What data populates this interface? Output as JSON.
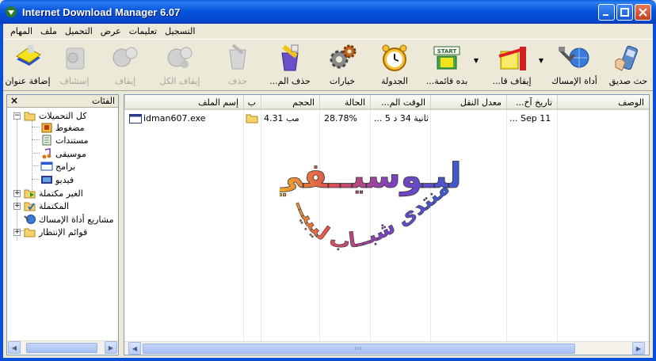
{
  "window": {
    "title": "Internet Download Manager 6.07"
  },
  "menu": [
    "المهام",
    "ملف",
    "التحميل",
    "عرض",
    "تعليمات",
    "التسجيل"
  ],
  "toolbar": {
    "buttons": [
      {
        "label": "إضافة عنوان",
        "icon": "add-url-icon",
        "disabled": false
      },
      {
        "label": "إستئناف",
        "icon": "resume-icon",
        "disabled": true
      },
      {
        "label": "إيقاف",
        "icon": "stop-icon",
        "disabled": true
      },
      {
        "label": "إيقاف الكل",
        "icon": "stop-all-icon",
        "disabled": true
      },
      {
        "label": "حذف",
        "icon": "delete-icon",
        "disabled": true
      },
      {
        "label": "...حذف الم",
        "icon": "delete-completed-icon",
        "disabled": false
      },
      {
        "label": "خيارات",
        "icon": "options-gear-icon",
        "disabled": false
      },
      {
        "label": "الجدولة",
        "icon": "scheduler-clock-icon",
        "disabled": false
      },
      {
        "label": "...بده قائمة",
        "icon": "start-queue-icon",
        "disabled": false
      },
      {
        "label": "...إيقاف قا",
        "icon": "stop-queue-icon",
        "disabled": false
      },
      {
        "label": "أداة الإمساك",
        "icon": "grabber-icon",
        "disabled": false
      },
      {
        "label": "حث صديق",
        "icon": "tell-friend-icon",
        "disabled": false
      }
    ]
  },
  "categories": {
    "title": "الفئات",
    "close": "×",
    "items": [
      {
        "label": "كل التحميلات",
        "icon": "folder-open-icon"
      },
      {
        "label": "مضغوط",
        "icon": "compressed-icon"
      },
      {
        "label": "مستندات",
        "icon": "documents-icon"
      },
      {
        "label": "موسيقى",
        "icon": "music-icon"
      },
      {
        "label": "برامج",
        "icon": "programs-icon"
      },
      {
        "label": "فيديو",
        "icon": "video-icon"
      },
      {
        "label": "الغير مكتملة",
        "icon": "unfinished-folder-icon"
      },
      {
        "label": "المكتملة",
        "icon": "finished-folder-icon"
      },
      {
        "label": "مشاريع أداة الإمساك",
        "icon": "grabber-projects-icon"
      },
      {
        "label": "قوائم الإنتظار",
        "icon": "queues-folder-icon"
      }
    ]
  },
  "columns": [
    "إسم الملف",
    "ب",
    "الحجم",
    "الحالة",
    "...الوقت الم",
    "معدل النقل",
    "...تاريخ آخ",
    "الوصف"
  ],
  "rows": [
    {
      "filename": "idman607.exe",
      "size": "4.31  مب",
      "status": "28.78%",
      "time_left": "ثانية 34 د 5 ...",
      "rate": "",
      "last_try": "... Sep 11",
      "description": ""
    }
  ],
  "watermark": {
    "line1": "البـوسيــفي",
    "line2": "منتدى شبــاب ليبيــا"
  }
}
